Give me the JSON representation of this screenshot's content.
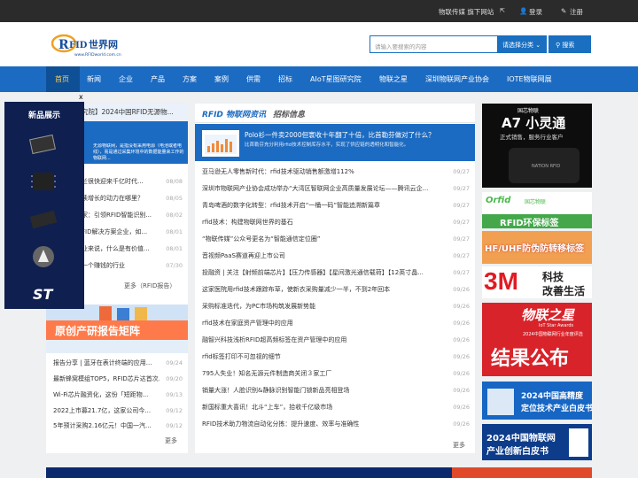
{
  "topbar": {
    "site": "物联传媒 旗下网站",
    "login": "登录",
    "register": "注册"
  },
  "header": {
    "logo_text": "RFID世界网",
    "logo_url": "www.RFIDworld.com.cn"
  },
  "search": {
    "placeholder": "请输入要搜索的内容",
    "category": "请选择分类",
    "button": "搜索"
  },
  "nav": [
    "首页",
    "新闻",
    "企业",
    "产品",
    "方案",
    "案例",
    "供需",
    "招标",
    "AIoT星图研究院",
    "物联之星",
    "深圳物联网产业协会",
    "IOTE物联网展"
  ],
  "popup": {
    "title": "新品展示"
  },
  "left": {
    "tab_text": "究院】2024中国RFID无源物...",
    "blue_text": "无源物联网，是指没有采用电源（电池或者电线），而是通过采集环境中的数据能量来工作的物联网...",
    "items": [
      {
        "t": "兰很快迎来千亿时代...",
        "d": "08/08"
      },
      {
        "t": "续增长的动力在哪里？",
        "d": "08/05"
      },
      {
        "t": "家：引领RFID智能识别...",
        "d": "08/02"
      },
      {
        "t": "FID解决方案企业，如...",
        "d": "08/01"
      },
      {
        "t": "业来说，什么是有价值...",
        "d": "08/01"
      },
      {
        "t": "一个赚钱的行业",
        "d": "07/30"
      }
    ],
    "more": "更多（RFID报告）",
    "banner": "原创产研报告矩阵",
    "items2": [
      {
        "t": "报告分享 | 蓝牙在表计终端的应用...",
        "d": "09/24"
      },
      {
        "t": "最新蜂窝模组TOP5，RFID芯片达首次...",
        "d": "09/20"
      },
      {
        "t": "Wi-Fi芯片融资化，这份「短距物...",
        "d": "09/13"
      },
      {
        "t": "2022上市募21.7亿，这家公司今...",
        "d": "09/12"
      },
      {
        "t": "5年预计采购2.16亿元！中国一汽...",
        "d": "09/12"
      }
    ],
    "more2": "更多"
  },
  "center": {
    "title": "RFID 物联网资讯",
    "subtitle": "招标信息",
    "feature_title": "Polo衫一件卖2000但寰收十年翻了十倍，比首勒芬做对了什么？",
    "feature_desc": "比首勒芬充分利用rfid技术控制库存水平，实现了供应链的透明化和智能化。",
    "items": [
      {
        "t": "亚马逊无人零售新时代：rfid技术驱动销售额激增112%",
        "d": "09/27"
      },
      {
        "t": "深圳市物联网产业协会成功举办“大湾区智联网企业高质量发展论坛——腾讯云企...",
        "d": "09/27"
      },
      {
        "t": "青岛啤酒的数字化转型：rfid技术开启“一桶一码”智能追溯新篇章",
        "d": "09/27"
      },
      {
        "t": "rfid技术：构建物联网世界的基石",
        "d": "09/27"
      },
      {
        "t": "“物联传媒”公众号更名为“智能通信定位圈”",
        "d": "09/27"
      },
      {
        "t": "音视频PaaS赛道再迎上市公司",
        "d": "09/27"
      },
      {
        "t": "投融资 | 关注【射频前端芯片】【压力传感器】【星间激光通信载荷】【12英寸晶...",
        "d": "09/27"
      },
      {
        "t": "这家医院用rfid技术跟踪布草，使新衣采购量减少一半，不到2年回本",
        "d": "09/26"
      },
      {
        "t": "采购标准迭代，为PC市场构筑发展新势能",
        "d": "09/26"
      },
      {
        "t": "rfid技术在家庭资产管理中的应用",
        "d": "09/26"
      },
      {
        "t": "融智兴科技浅析RFID超高频标签在资产管理中的应用",
        "d": "09/26"
      },
      {
        "t": "rfid标签打印不可忽视的细节",
        "d": "09/26"
      },
      {
        "t": "795人失业！知名无源元件制造商关闭３家工厂",
        "d": "09/26"
      },
      {
        "t": "销量大涨！人脸识别&静脉识别智能门锁新品亮相登场",
        "d": "09/26"
      },
      {
        "t": "新国标重大喜讯！北斗“上车”，拾收千亿级市场",
        "d": "09/26"
      },
      {
        "t": "RFID技术助力物流自动化分拣：提升速度、效率与准确性",
        "d": "09/26"
      }
    ],
    "more": "更多"
  },
  "ads": [
    {
      "l1": "国芯物联",
      "l2": "A7 小灵通",
      "l3": "正式销售，服务行业客户",
      "l4": "NATION RFID"
    },
    {
      "l1": "国芯物联",
      "l2": "RFID环保标签"
    },
    {
      "l1": "HF/UHF防伪防转移标签"
    },
    {
      "l1": "3M",
      "l2": "科技",
      "l3": "改善生活"
    },
    {
      "l1": "物联之星",
      "l2": "IoT Star Awards",
      "l3": "2024中国物联网行业年度评选",
      "l4": "结果公布"
    },
    {
      "l1": "2024中国高精度",
      "l2": "定位技术产业白皮书"
    },
    {
      "l1": "2024中国物联网",
      "l2": "产业创新白皮书"
    }
  ],
  "colors": {
    "nav": "#1c6bc2",
    "topbar": "#2b2b2b",
    "accent": "#ffd24a"
  }
}
